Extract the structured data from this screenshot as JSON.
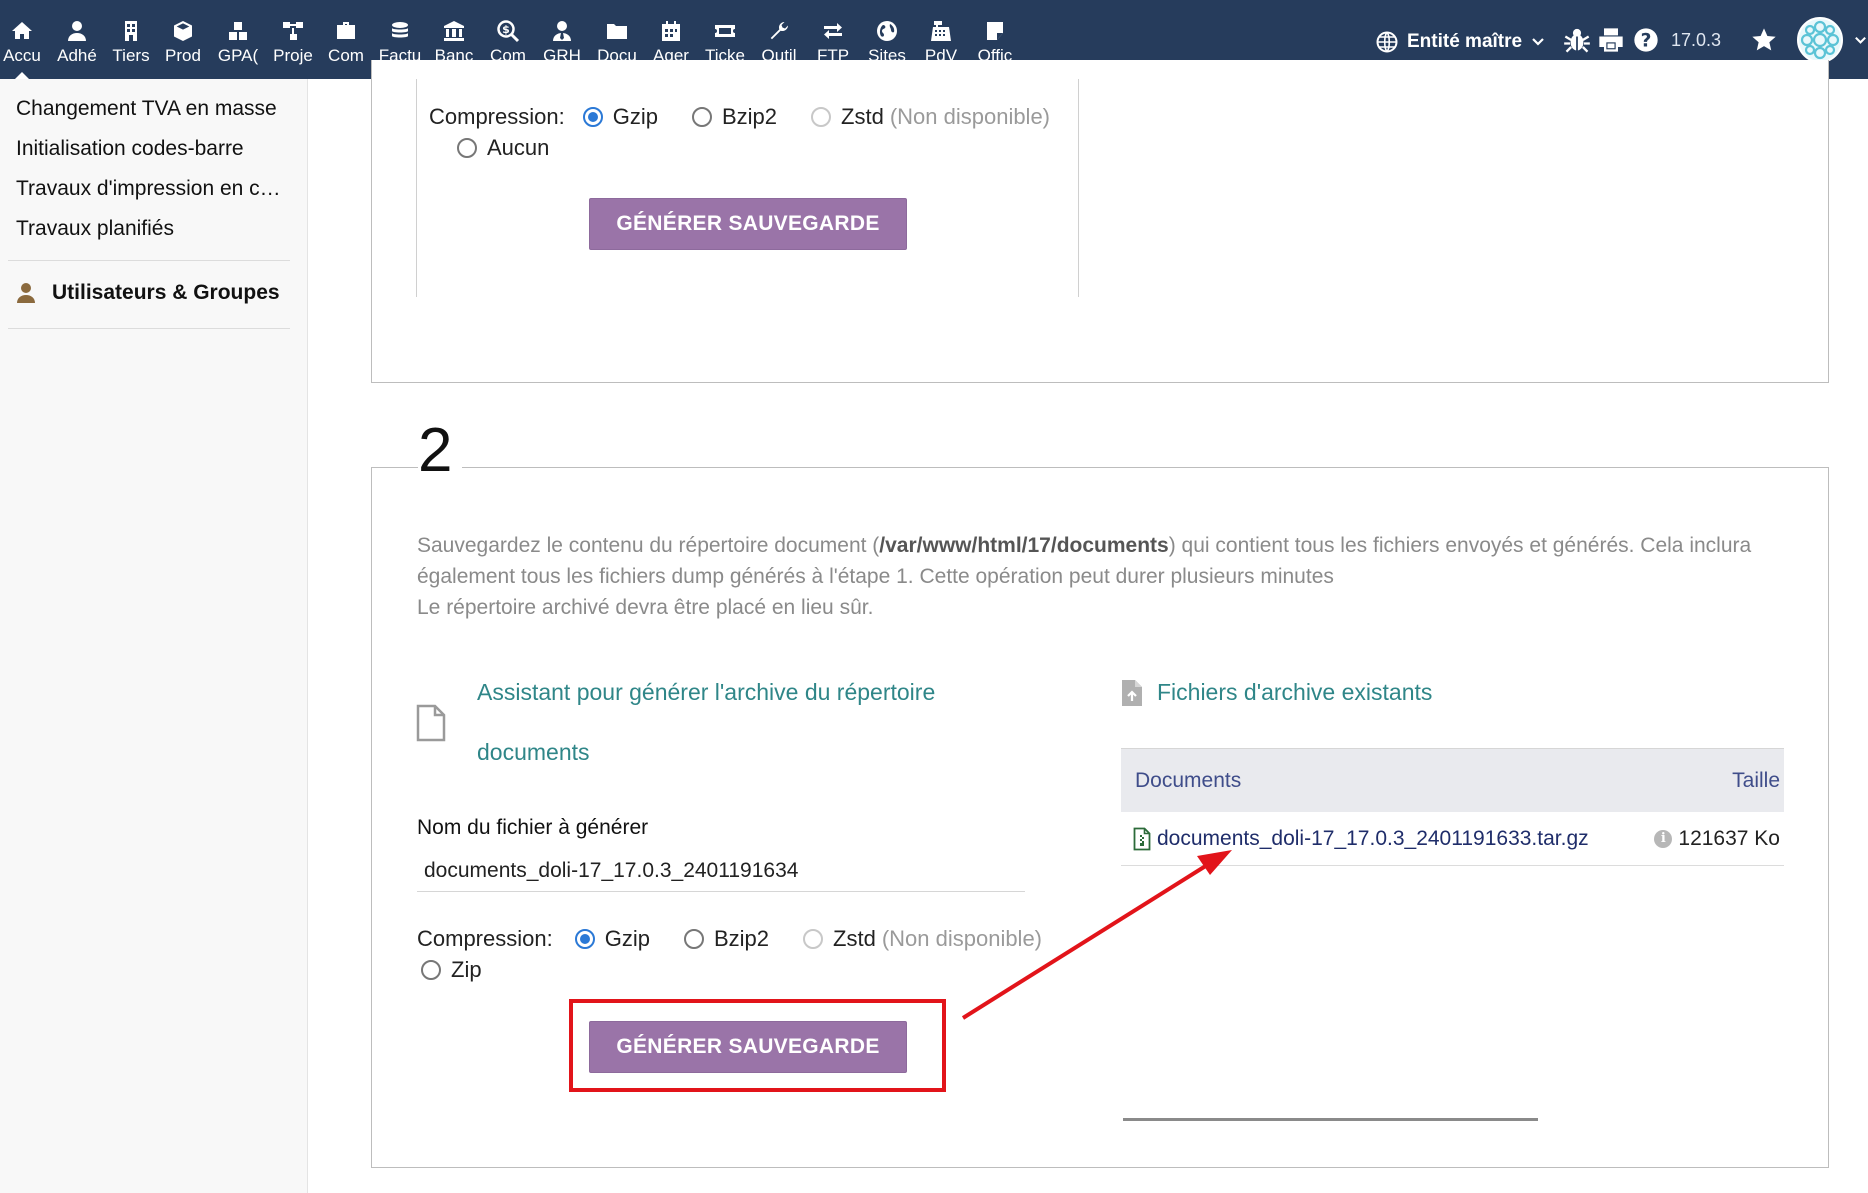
{
  "topbar": {
    "menu": [
      {
        "label": "Accu",
        "icon": "home-icon",
        "active": true
      },
      {
        "label": "Adhé",
        "icon": "member-icon"
      },
      {
        "label": "Tiers",
        "icon": "building-icon"
      },
      {
        "label": "Prod",
        "icon": "box-icon"
      },
      {
        "label": "GPA(",
        "icon": "cubes-icon"
      },
      {
        "label": "Proje",
        "icon": "project-icon"
      },
      {
        "label": "Com",
        "icon": "briefcase-icon"
      },
      {
        "label": "Factu",
        "icon": "coins-icon"
      },
      {
        "label": "Banc",
        "icon": "bank-icon"
      },
      {
        "label": "Com",
        "icon": "search-dollar-icon"
      },
      {
        "label": "GRH",
        "icon": "user-tie-icon"
      },
      {
        "label": "Docu",
        "icon": "folder-icon"
      },
      {
        "label": "Ager",
        "icon": "calendar-icon"
      },
      {
        "label": "Ticke",
        "icon": "ticket-icon"
      },
      {
        "label": "Outil",
        "icon": "wrench-icon"
      },
      {
        "label": "FTP",
        "icon": "exchange-icon"
      },
      {
        "label": "Sites",
        "icon": "globe-icon"
      },
      {
        "label": "PdV",
        "icon": "cash-register-icon"
      },
      {
        "label": "Offic",
        "icon": "sticky-note-icon"
      }
    ],
    "entity_label": "Entité maître",
    "version": "17.0.3"
  },
  "sidebar": {
    "links": [
      "Changement TVA en masse",
      "Initialisation codes-barre",
      "Travaux d'impression en cours",
      "Travaux planifiés"
    ],
    "users_group_label": "Utilisateurs & Groupes"
  },
  "step1": {
    "compression_label": "Compression:",
    "options": [
      {
        "label": "Gzip",
        "state": "checked"
      },
      {
        "label": "Bzip2",
        "state": "unchecked"
      },
      {
        "label": "Zstd",
        "state": "disabled",
        "note": "(Non disponible)"
      },
      {
        "label": "Aucun",
        "state": "unchecked"
      }
    ],
    "button_label": "GÉNÉRER SAUVEGARDE"
  },
  "step2": {
    "number": "2",
    "desc_before": "Sauvegardez le contenu du répertoire document (",
    "desc_path": "/var/www/html/17/documents",
    "desc_after": ") qui contient tous les fichiers envoyés et générés. Cela inclura également tous les fichiers dump générés à l'étape 1. Cette opération peut durer plusieurs minutes",
    "desc_line2": "Le répertoire archivé devra être placé en lieu sûr.",
    "wizard_title": "Assistant pour générer l'archive du répertoire documents",
    "filename_label": "Nom du fichier à générer",
    "filename_value": "documents_doli-17_17.0.3_2401191634",
    "compression_label": "Compression:",
    "options": [
      {
        "label": "Gzip",
        "state": "checked"
      },
      {
        "label": "Bzip2",
        "state": "unchecked"
      },
      {
        "label": "Zstd",
        "state": "disabled",
        "note": "(Non disponible)"
      },
      {
        "label": "Zip",
        "state": "unchecked"
      }
    ],
    "button_label": "GÉNÉRER SAUVEGARDE",
    "existing_title": "Fichiers d'archive existants",
    "table": {
      "col_documents": "Documents",
      "col_size": "Taille",
      "rows": [
        {
          "name": "documents_doli-17_17.0.3_2401191633.tar.gz",
          "size": "121637 Ko"
        }
      ]
    }
  },
  "colors": {
    "topbar": "#263c5c",
    "button": "#9a74a8",
    "link_title": "#2f8688",
    "highlight": "#e2141a",
    "radio_checked": "#2b79d6"
  }
}
